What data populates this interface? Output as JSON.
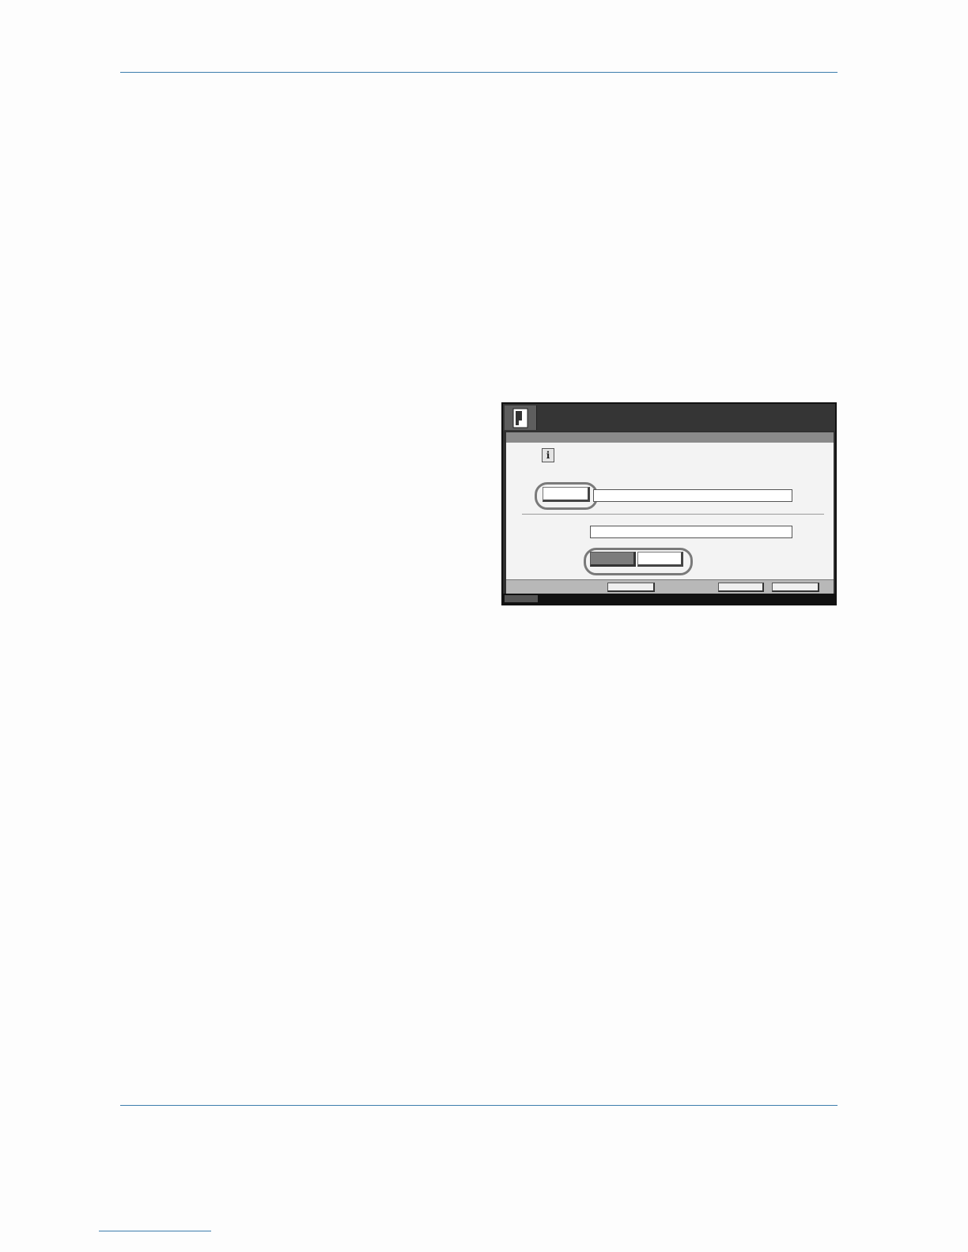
{
  "page": {
    "icons": {
      "panel_icon": "document-icon",
      "info_icon": "info-icon"
    },
    "colors": {
      "rule": "#3c7dad",
      "highlight": "#7a7a7a"
    },
    "panel": {
      "info_glyph": "i"
    }
  }
}
